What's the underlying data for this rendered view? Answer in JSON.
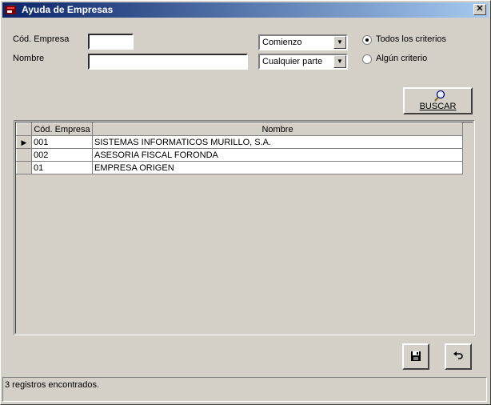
{
  "window": {
    "title": "Ayuda de Empresas",
    "close_glyph": "✕"
  },
  "form": {
    "codigo_label": "Cód. Empresa",
    "codigo_value": "",
    "nombre_label": "Nombre",
    "nombre_value": "",
    "match_codigo": "Comienzo",
    "match_nombre": "Cualquier parte",
    "radio_all": "Todos los criterios",
    "radio_any": "Algún criterio",
    "radio_selected": "all"
  },
  "search_button": {
    "label": "BUSCAR",
    "icon": "magnifier-icon"
  },
  "grid": {
    "columns": [
      "Cód. Empresa",
      "Nombre"
    ],
    "rows": [
      {
        "codigo": "001",
        "nombre": "SISTEMAS INFORMATICOS MURILLO, S.A.",
        "current": true
      },
      {
        "codigo": "002",
        "nombre": "ASESORIA FISCAL FORONDA",
        "current": false
      },
      {
        "codigo": "01",
        "nombre": "EMPRESA ORIGEN",
        "current": false
      }
    ]
  },
  "actions": {
    "save_icon": "floppy-disk-icon",
    "undo_icon": "undo-arrow-icon"
  },
  "status": {
    "text": "3 registros encontrados."
  }
}
